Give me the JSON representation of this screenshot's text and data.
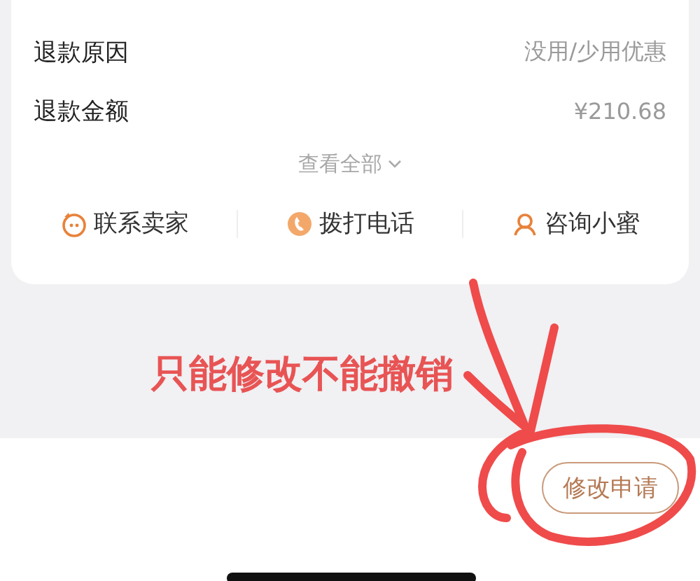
{
  "details": [
    {
      "label": "退款原因",
      "value": "没用/少用优惠"
    },
    {
      "label": "退款金额",
      "value": "¥210.68"
    }
  ],
  "view_all": "查看全部",
  "actions": [
    {
      "kind": "chat",
      "label": "联系卖家"
    },
    {
      "kind": "phone",
      "label": "拨打电话"
    },
    {
      "kind": "service",
      "label": "咨询小蜜"
    }
  ],
  "annotation": "只能修改不能撤销",
  "bottom_button": "修改申请"
}
